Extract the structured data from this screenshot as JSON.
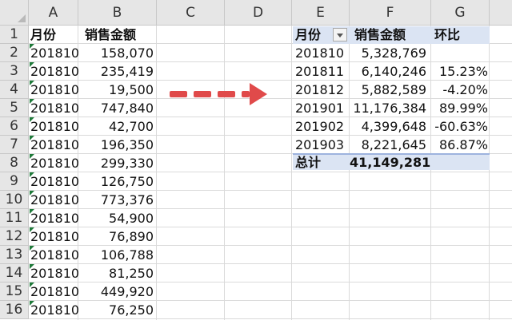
{
  "columns": [
    "A",
    "B",
    "C",
    "D",
    "E",
    "F",
    "G"
  ],
  "rows": [
    "1",
    "2",
    "3",
    "4",
    "5",
    "6",
    "7",
    "8",
    "9",
    "10",
    "11",
    "12",
    "13",
    "14",
    "15",
    "16"
  ],
  "source_table": {
    "headers": [
      "月份",
      "销售金额"
    ],
    "rows": [
      [
        "201810",
        "158,070"
      ],
      [
        "201810",
        "235,419"
      ],
      [
        "201810",
        "19,500"
      ],
      [
        "201810",
        "747,840"
      ],
      [
        "201810",
        "42,700"
      ],
      [
        "201810",
        "196,350"
      ],
      [
        "201810",
        "299,330"
      ],
      [
        "201810",
        "126,750"
      ],
      [
        "201810",
        "773,376"
      ],
      [
        "201810",
        "54,900"
      ],
      [
        "201810",
        "76,890"
      ],
      [
        "201810",
        "106,788"
      ],
      [
        "201810",
        "81,250"
      ],
      [
        "201810",
        "449,920"
      ],
      [
        "201810",
        "76,250"
      ]
    ]
  },
  "pivot_table": {
    "headers": [
      "月份",
      "销售金额",
      "环比"
    ],
    "rows": [
      [
        "201810",
        "5,328,769",
        ""
      ],
      [
        "201811",
        "6,140,246",
        "15.23%"
      ],
      [
        "201812",
        "5,882,589",
        "-4.20%"
      ],
      [
        "201901",
        "11,176,384",
        "89.99%"
      ],
      [
        "201902",
        "4,399,648",
        "-60.63%"
      ],
      [
        "201903",
        "8,221,645",
        "86.87%"
      ]
    ],
    "total_label": "总计",
    "total_value": "41,149,281",
    "header_bg": "#dbe4f3"
  },
  "arrow_color": "#e04a4a"
}
